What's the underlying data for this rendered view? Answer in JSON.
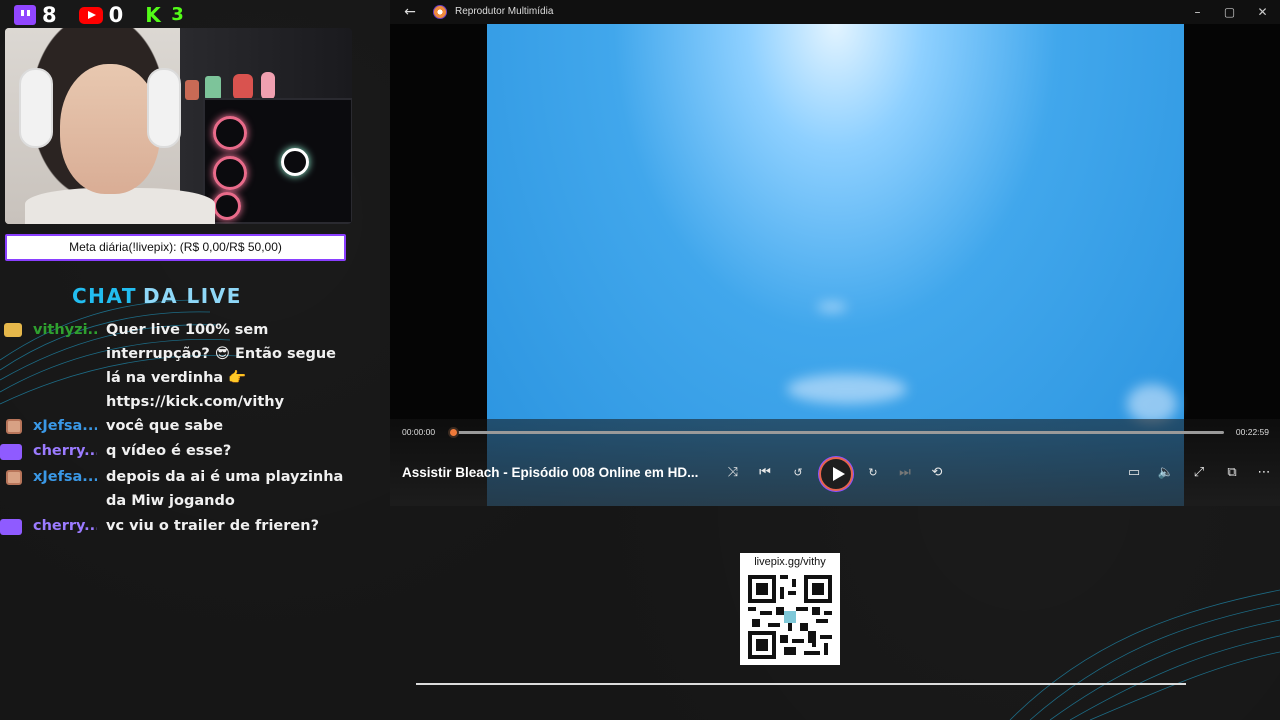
{
  "counters": {
    "twitch": "8",
    "youtube": "0",
    "kick": "3"
  },
  "goal": {
    "text": "Meta diária(!livepix): (R$ 0,00/R$ 50,00)"
  },
  "chat": {
    "title_part1": "CHAT",
    "title_part2": "DA LIVE",
    "messages": [
      {
        "user": "vithyzi...",
        "text": "Quer live 100% sem interrupção? 😎 Então segue lá na verdinha 👉 https://kick.com/vithy"
      },
      {
        "user": "xJefsa...",
        "text": "você que sabe"
      },
      {
        "user": "cherry...",
        "text": "q vídeo é esse?"
      },
      {
        "user": "xJefsa...",
        "text": "depois da ai é uma playzinha da Miw jogando"
      },
      {
        "user": "cherry...",
        "text": "vc viu o trailer de frieren?"
      }
    ]
  },
  "player": {
    "app_title": "Reprodutor Multimídia",
    "time_current": "00:00:00",
    "time_total": "00:22:59",
    "progress": 0.0,
    "video_title": "Assistir Bleach - Episódio 008 Online em HD...",
    "accent_color": "#f07a3a"
  },
  "qr": {
    "label": "livepix.gg/vithy"
  }
}
